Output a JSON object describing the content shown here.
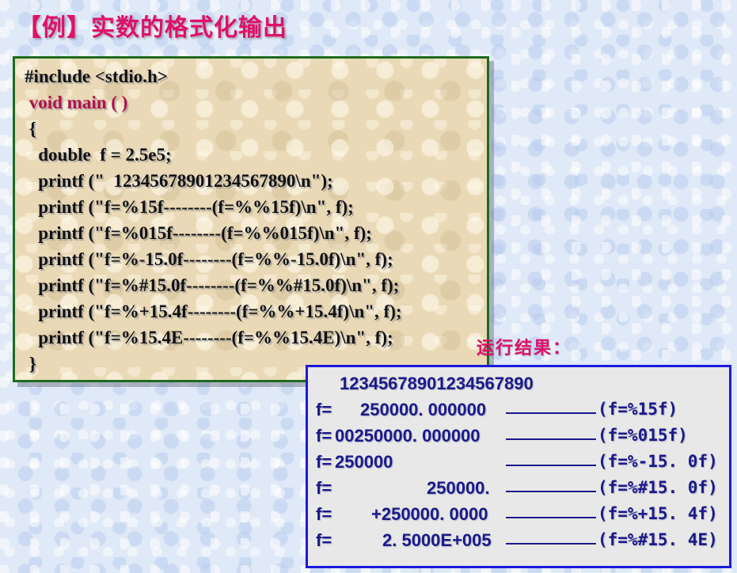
{
  "title": "【例】实数的格式化输出",
  "code": [
    "#include <stdio.h>",
    " void main ( )",
    " {",
    "   double  f = 2.5e5;",
    "   printf (\"  12345678901234567890\\n\");",
    "   printf (\"f=%15f--------(f=%%15f)\\n\", f);",
    "   printf (\"f=%015f--------(f=%%015f)\\n\", f);",
    "   printf (\"f=%-15.0f--------(f=%%-15.0f)\\n\", f);",
    "   printf (\"f=%#15.0f--------(f=%%#15.0f)\\n\", f);",
    "   printf (\"f=%+15.4f--------(f=%%+15.4f)\\n\", f);",
    "   printf (\"f=%15.4E--------(f=%%15.4E)\\n\", f);",
    " }"
  ],
  "result_label": "运行结果：",
  "output": {
    "ruler": "12345678901234567890",
    "rows": [
      {
        "prefix": "f=",
        "value": "250000. 000000",
        "format": "(f=%15f)"
      },
      {
        "prefix": "f=",
        "value": "00250000. 000000",
        "format": "(f=%015f)"
      },
      {
        "prefix": "f=",
        "value": "250000",
        "format": "(f=%-15. 0f)"
      },
      {
        "prefix": "f=",
        "value": "250000.",
        "format": "(f=%#15. 0f)"
      },
      {
        "prefix": "f=",
        "value": "+250000. 0000",
        "format": "(f=%+15. 4f)"
      },
      {
        "prefix": "f=",
        "value": "2. 5000E+005",
        "format": "(f=%#15. 4E)"
      }
    ]
  },
  "colors": {
    "title": "#e0106a",
    "code_border": "#1e6b1e",
    "output_border": "#1a1adc",
    "output_text": "#1a1a8c"
  }
}
